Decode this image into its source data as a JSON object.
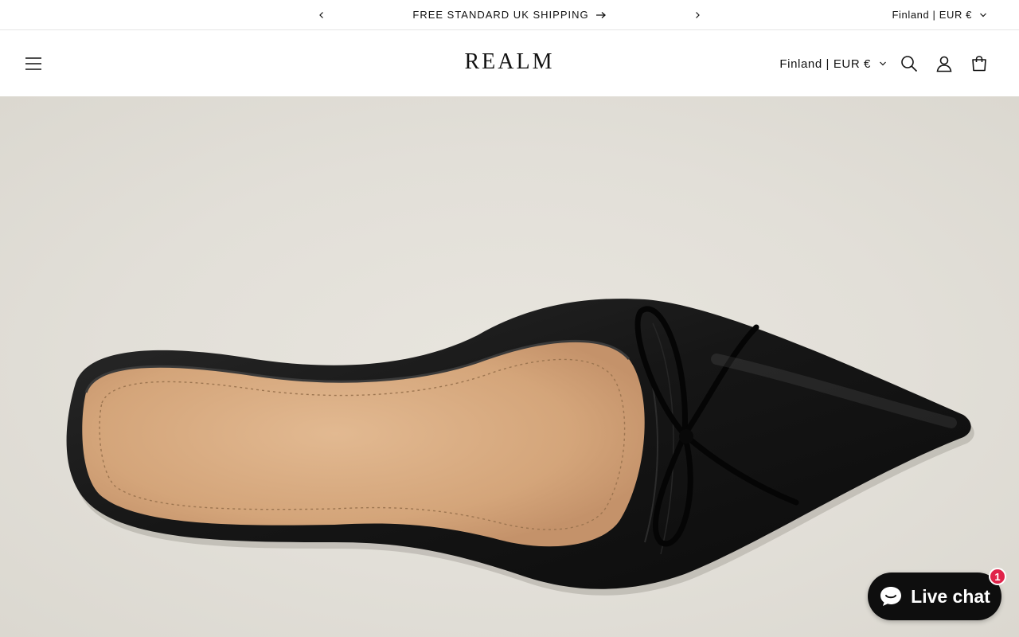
{
  "announcement": {
    "message": "FREE STANDARD UK SHIPPING",
    "prev_icon": "chevron-left-icon",
    "next_icon": "chevron-right-icon",
    "link_icon": "arrow-right-icon",
    "locale": "Finland | EUR €"
  },
  "header": {
    "brand": "REALM",
    "locale": "Finland | EUR €",
    "icons": [
      "menu-icon",
      "search-icon",
      "account-icon",
      "cart-icon"
    ]
  },
  "hero": {
    "image": "black-leather-pointed-mule-with-bow"
  },
  "chat": {
    "label": "Live chat",
    "badge_count": "1",
    "icon": "chat-bubble-icon"
  },
  "colors": {
    "text": "#121212",
    "background": "#ffffff",
    "chat_bg": "#0e0e0e",
    "badge": "#e0234a"
  }
}
